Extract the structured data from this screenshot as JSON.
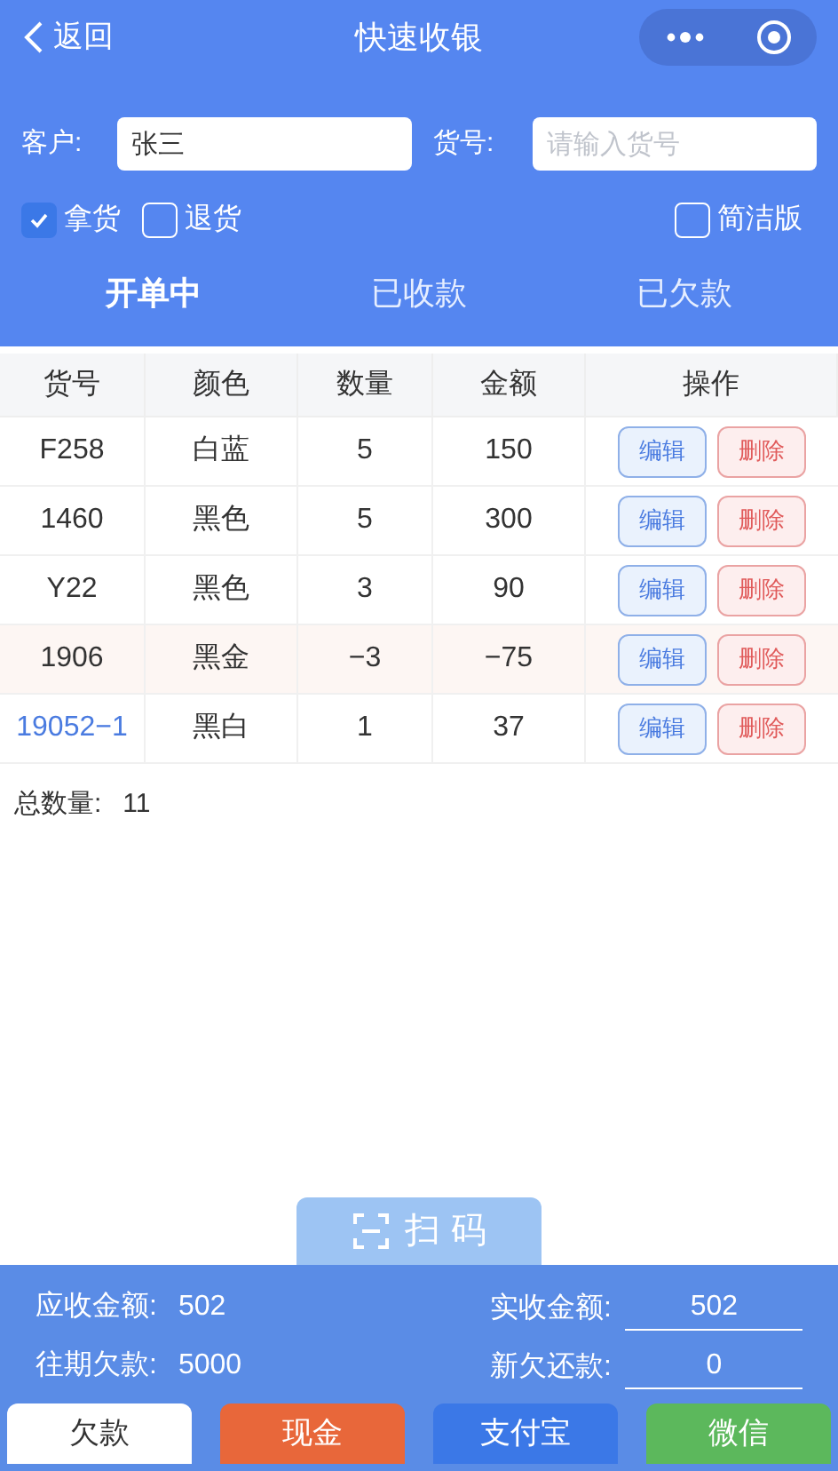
{
  "nav": {
    "back": "返回",
    "title": "快速收银"
  },
  "form": {
    "customer_label": "客户:",
    "customer_value": "张三",
    "goods_label": "货号:",
    "goods_placeholder": "请输入货号"
  },
  "options": [
    {
      "label": "拿货",
      "checked": true
    },
    {
      "label": "退货",
      "checked": false
    }
  ],
  "simple_mode": {
    "label": "简洁版",
    "checked": false
  },
  "status_tabs": [
    {
      "label": "开单中",
      "selected": true
    },
    {
      "label": "已收款",
      "selected": false
    },
    {
      "label": "已欠款",
      "selected": false
    }
  ],
  "table": {
    "columns": [
      "货号",
      "颜色",
      "数量",
      "金额",
      "操作"
    ],
    "rows": [
      {
        "goods_no": "F258",
        "color_name": "白蓝",
        "qty": "5",
        "amount": "150",
        "edit": "编辑",
        "delete": "删除",
        "kind": "take",
        "highlighted": false
      },
      {
        "goods_no": "1460",
        "color_name": "黑色",
        "qty": "5",
        "amount": "300",
        "edit": "编辑",
        "delete": "删除",
        "kind": "take",
        "highlighted": false
      },
      {
        "goods_no": "Y22",
        "color_name": "黑色",
        "qty": "3",
        "amount": "90",
        "edit": "编辑",
        "delete": "删除",
        "kind": "take",
        "highlighted": false
      },
      {
        "goods_no": "1906",
        "color_name": "黑金",
        "qty": "−3",
        "amount": "−75",
        "edit": "编辑",
        "delete": "删除",
        "kind": "return",
        "highlighted": false
      },
      {
        "goods_no": "19052−1",
        "color_name": "黑白",
        "qty": "1",
        "amount": "37",
        "edit": "编辑",
        "delete": "删除",
        "kind": "take",
        "highlighted": true
      }
    ]
  },
  "total": {
    "label": "总数量:",
    "value": "11"
  },
  "scan_button": "扫 码",
  "summary": {
    "receivable_label": "应收金额:",
    "receivable": "502",
    "received_label": "实收金额:",
    "received": "502",
    "previous_debt_label": "往期欠款:",
    "previous_debt": "5000",
    "new_debt_label": "新欠还款:",
    "new_debt": "0"
  },
  "pay_buttons": [
    {
      "label": "欠款",
      "kind": "debt"
    },
    {
      "label": "现金",
      "kind": "cash"
    },
    {
      "label": "支付宝",
      "kind": "alipay"
    },
    {
      "label": "微信",
      "kind": "wechat"
    }
  ]
}
